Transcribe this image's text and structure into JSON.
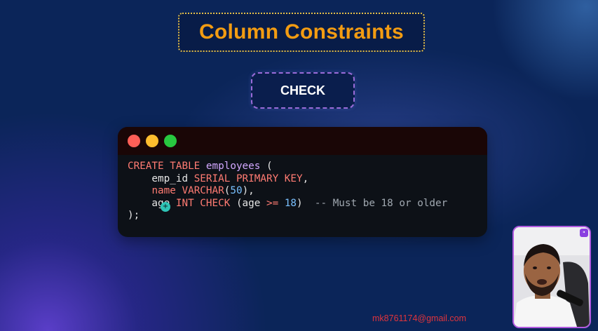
{
  "title": "Column Constraints",
  "check_button": {
    "label": "CHECK"
  },
  "code_window": {
    "dots": [
      {
        "name": "close-dot",
        "color": "#ff5f57"
      },
      {
        "name": "minimize-dot",
        "color": "#ffbd2e"
      },
      {
        "name": "maximize-dot",
        "color": "#28c840"
      }
    ],
    "lines": [
      [
        {
          "t": "CREATE TABLE ",
          "c": "kw"
        },
        {
          "t": "employees",
          "c": "id"
        },
        {
          "t": " (",
          "c": "plain"
        }
      ],
      [
        {
          "t": "    emp_id ",
          "c": "plain"
        },
        {
          "t": "SERIAL PRIMARY KEY",
          "c": "kw"
        },
        {
          "t": ",",
          "c": "plain"
        }
      ],
      [
        {
          "t": "    ",
          "c": "plain"
        },
        {
          "t": "name",
          "c": "kw"
        },
        {
          "t": " ",
          "c": "plain"
        },
        {
          "t": "VARCHAR",
          "c": "kw"
        },
        {
          "t": "(",
          "c": "plain"
        },
        {
          "t": "50",
          "c": "num"
        },
        {
          "t": "),",
          "c": "plain"
        }
      ],
      [
        {
          "t": "    age ",
          "c": "plain"
        },
        {
          "t": "INT CHECK",
          "c": "kw"
        },
        {
          "t": " (age ",
          "c": "plain"
        },
        {
          "t": ">=",
          "c": "op"
        },
        {
          "t": " ",
          "c": "plain"
        },
        {
          "t": "18",
          "c": "num"
        },
        {
          "t": ")  ",
          "c": "plain"
        },
        {
          "t": "-- Must be 18 or older",
          "c": "cm"
        }
      ],
      [
        {
          "t": ");",
          "c": "plain"
        }
      ]
    ]
  },
  "cursor_badge_icon": "plus-icon",
  "email": "mk8761174@gmail.com",
  "webcam": {
    "badge_icon": "pin-icon"
  }
}
